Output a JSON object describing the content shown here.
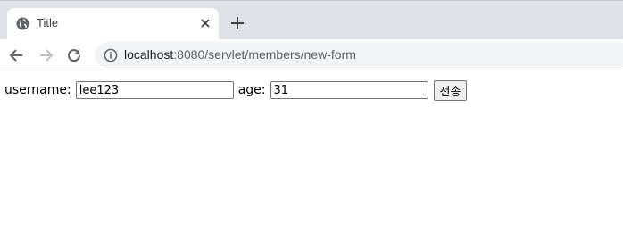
{
  "tab": {
    "title": "Title",
    "icons": {
      "favicon": "globe-icon",
      "close": "close-icon",
      "new_tab": "plus-icon"
    }
  },
  "toolbar": {
    "back_icon": "arrow-left-icon",
    "forward_icon": "arrow-right-icon",
    "reload_icon": "reload-icon",
    "info_icon": "info-icon",
    "url_host": "localhost",
    "url_path": ":8080/servlet/members/new-form"
  },
  "form": {
    "username_label": "username:",
    "username_value": "lee123",
    "age_label": "age:",
    "age_value": "31",
    "submit_label": "전송"
  },
  "colors": {
    "tabstrip": "#dee1e6",
    "omnibox": "#f1f3f4",
    "icon": "#5f6368"
  }
}
